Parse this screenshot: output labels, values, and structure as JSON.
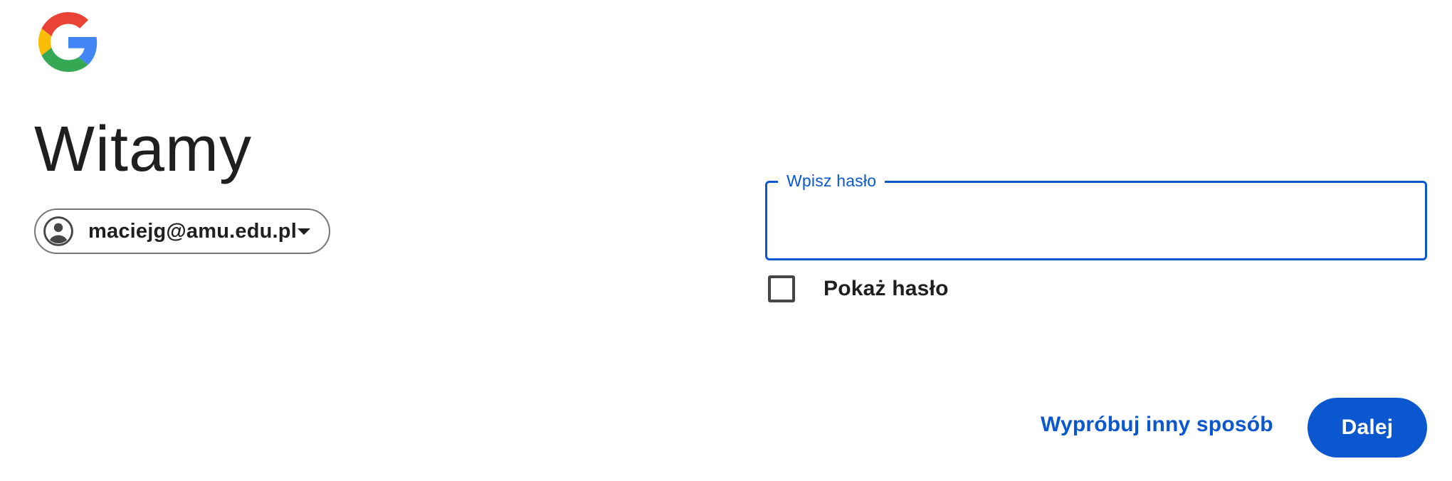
{
  "branding": {
    "logo_icon": "google-g-icon",
    "colors": {
      "red": "#EA4335",
      "yellow": "#FBBC05",
      "green": "#34A853",
      "blue": "#4285F4"
    }
  },
  "header": {
    "title": "Witamy"
  },
  "account": {
    "email": "maciejg@amu.edu.pl",
    "avatar_icon": "account-circle-icon",
    "dropdown_icon": "caret-down-icon"
  },
  "password": {
    "label": "Wpisz hasło",
    "value": "",
    "show_password_label": "Pokaż hasło",
    "show_password_checked": false
  },
  "actions": {
    "try_another_label": "Wypróbuj inny sposób",
    "next_label": "Dalej"
  },
  "theme": {
    "accent": "#0B57D0",
    "text": "#1F1F1F",
    "outline": "#747775"
  }
}
